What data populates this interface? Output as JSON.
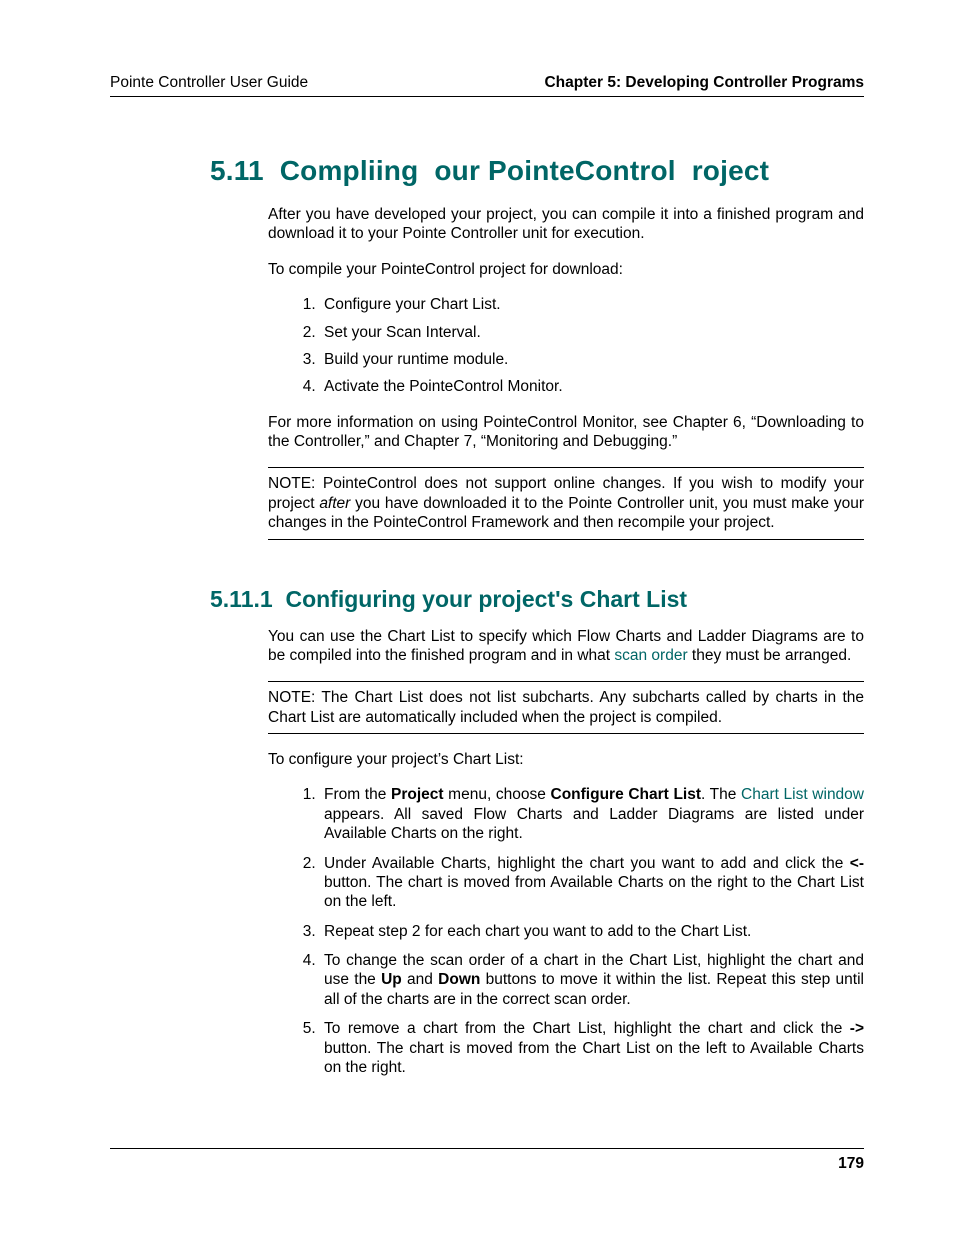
{
  "header": {
    "left": "Pointe Controller User Guide",
    "right": "Chapter 5: Developing Controller Programs"
  },
  "sec511": {
    "num": "5.11",
    "title": "Compliing  our PointeControl  roject",
    "p1": "After you have developed your project, you can compile it into a finished program and download it to your Pointe Controller unit for execution.",
    "p2": "To compile your PointeControl project for download:",
    "steps": {
      "s1": "Configure your Chart List.",
      "s2": "Set your Scan Interval.",
      "s3": "Build your runtime module.",
      "s4": "Activate the PointeControl Monitor."
    },
    "p3": "For more information on using PointeControl Monitor, see Chapter 6, “Downloading to the Controller,” and Chapter 7, “Monitoring and Debugging.”",
    "note_pre": "NOTE: PointeControl does not support online changes. If you wish to modify your project ",
    "note_after_word": "after",
    "note_post": " you have downloaded it to the Pointe Controller unit, you must make your changes in the PointeControl Framework and then recompile your project."
  },
  "sec5111": {
    "num": "5.11.1",
    "title": "Configuring your project's Chart List",
    "p1a": "You can use the Chart List to specify which Flow Charts and Ladder Diagrams are to be compiled into the finished program and in what ",
    "p1_link": "scan order",
    "p1b": " they must be arranged.",
    "note": "NOTE: The Chart List does not list subcharts. Any subcharts called by charts in the Chart List are automatically included when the project is compiled.",
    "p2": "To configure your project’s Chart List:",
    "step1_a": "From the ",
    "step1_b_project": "Project",
    "step1_c": " menu, choose ",
    "step1_d_ccl": "Configure Chart List",
    "step1_e": ". The ",
    "step1_f_link": "Chart List window",
    "step1_g": " appears. All saved Flow Charts and Ladder Diagrams are listed under Available Charts on the right.",
    "step2_a": "Under Available Charts, highlight the chart you want to add and click the ",
    "step2_b_btn": "<-",
    "step2_c": " button. The chart is moved from Available Charts on the right to the Chart List on the left.",
    "step3": "Repeat step 2 for each chart you want to add to the Chart List.",
    "step4_a": "To change the scan order of a chart in the Chart List, highlight the chart and use the ",
    "step4_up": "Up",
    "step4_b": " and ",
    "step4_down": "Down",
    "step4_c": " buttons to move it within the list. Repeat this step until all of the charts are in the correct scan order.",
    "step5_a": "To remove a chart from the Chart List, highlight the chart and click the ",
    "step5_btn": "->",
    "step5_b": " button. The chart is moved from the Chart List on the left to Available Charts on the right."
  },
  "footer": {
    "page": "179"
  }
}
